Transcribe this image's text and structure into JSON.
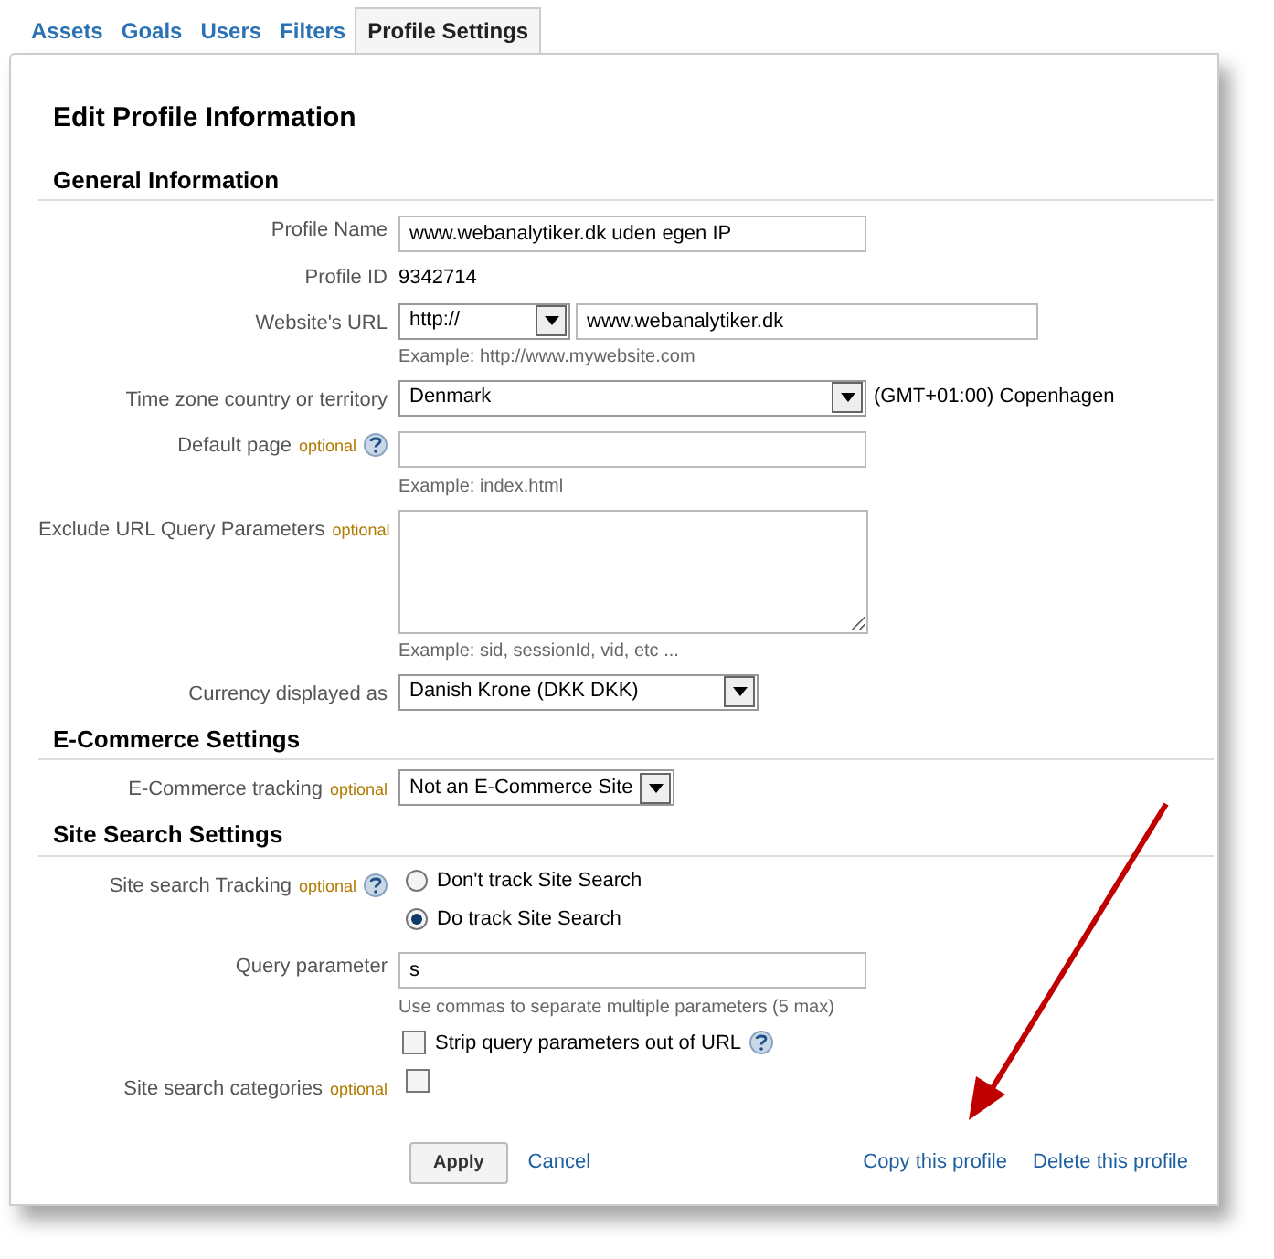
{
  "tabs": [
    {
      "label": "Assets",
      "selected": false
    },
    {
      "label": "Goals",
      "selected": false
    },
    {
      "label": "Users",
      "selected": false
    },
    {
      "label": "Filters",
      "selected": false
    },
    {
      "label": "Profile Settings",
      "selected": true
    }
  ],
  "title": "Edit Profile Information",
  "sections": [
    {
      "heading": "General Information",
      "rows": [
        {
          "kind": "input",
          "label": "Profile Name",
          "value": "www.webanalytiker.dk uden egen IP"
        },
        {
          "kind": "static",
          "label": "Profile ID",
          "value": "9342714"
        },
        {
          "kind": "url",
          "label": "Website's URL",
          "protocol": "http://",
          "value": "www.webanalytiker.dk",
          "hint": "Example: http://www.mywebsite.com"
        },
        {
          "kind": "select",
          "label": "Time zone country or territory",
          "value": "Denmark",
          "after": "(GMT+01:00) Copenhagen"
        },
        {
          "kind": "input",
          "label": "Default page",
          "optional": "optional",
          "help": true,
          "value": "",
          "hint": "Example: index.html"
        },
        {
          "kind": "textarea",
          "label": "Exclude URL Query Parameters",
          "optional": "optional",
          "hint": "Example: sid, sessionId, vid, etc ..."
        },
        {
          "kind": "select",
          "label": "Currency displayed as",
          "value": "Danish Krone (DKK DKK)"
        }
      ]
    },
    {
      "heading": "E-Commerce Settings",
      "rows": [
        {
          "kind": "select",
          "label": "E-Commerce tracking",
          "optional": "optional",
          "value": "Not an E-Commerce Site"
        }
      ]
    },
    {
      "heading": "Site Search Settings",
      "rows": [
        {
          "kind": "radios",
          "label": "Site search Tracking",
          "optional": "optional",
          "help": true,
          "options": [
            {
              "label": "Don't track Site Search",
              "selected": false
            },
            {
              "label": "Do track Site Search",
              "selected": true
            }
          ]
        },
        {
          "kind": "input",
          "label": "Query parameter",
          "value": "s",
          "hint": "Use commas to separate multiple parameters (5 max)",
          "checkbox": {
            "label": "Strip query parameters out of URL",
            "checked": false,
            "help": true
          }
        },
        {
          "kind": "checkbox",
          "label": "Site search categories",
          "optional": "optional",
          "checked": false
        }
      ]
    }
  ],
  "apply": "Apply",
  "cancel": "Cancel",
  "links": [
    "Copy this profile",
    "Delete this profile"
  ]
}
